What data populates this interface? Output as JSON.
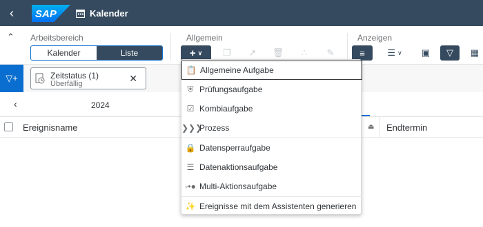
{
  "shell": {
    "title": "Kalender",
    "logo": "SAP",
    "icons": [
      "back-icon",
      "calendar-icon"
    ]
  },
  "toolbar": {
    "groups": {
      "workspace": "Arbeitsbereich",
      "general": "Allgemein",
      "display": "Anzeigen"
    },
    "segments": [
      "Kalender",
      "Liste"
    ],
    "selected_segment": "Liste",
    "icons": [
      "add-icon",
      "copy-icon",
      "share-icon",
      "delete-icon",
      "filter-merge-icon",
      "edit-icon",
      "column-icon",
      "list-settings-icon",
      "schedule-icon",
      "filter-icon",
      "film-icon"
    ]
  },
  "filter": {
    "token_title": "Zeitstatus (1)",
    "token_value": "Überfällig"
  },
  "nav": {
    "year": "2024"
  },
  "table": {
    "col1": "Ereignisname",
    "col2": "Endtermin"
  },
  "menu": {
    "items": [
      {
        "label": "Allgemeine Aufgabe",
        "icon": "clipboard-icon"
      },
      {
        "label": "Prüfungsaufgabe",
        "icon": "shield-icon"
      },
      {
        "label": "Kombiaufgabe",
        "icon": "combo-clipboard-icon"
      },
      {
        "label": "Prozess",
        "icon": "process-icon"
      },
      {
        "label": "Datensperraufgabe",
        "icon": "lock-icon"
      },
      {
        "label": "Datenaktionsaufgabe",
        "icon": "data-action-icon"
      },
      {
        "label": "Multi-Aktionsaufgabe",
        "icon": "multi-action-icon"
      },
      {
        "label": "Ereignisse mit dem Assistenten generieren",
        "icon": "wizard-icon"
      }
    ]
  },
  "colors": {
    "shell": "#354a5f",
    "accent": "#0a6ed1"
  }
}
